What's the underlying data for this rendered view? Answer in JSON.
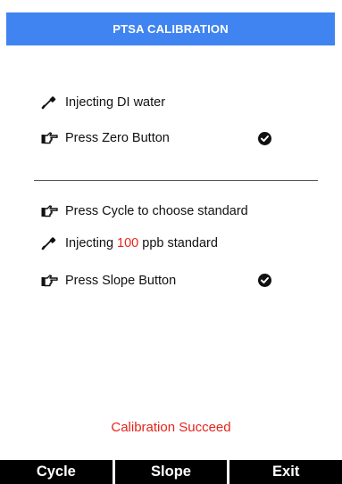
{
  "title": "PTSA CALIBRATION",
  "zero_section": {
    "inject_text": "Injecting DI water",
    "press_zero_text": "Press Zero Button",
    "zero_done": true
  },
  "slope_section": {
    "cycle_text": "Press Cycle to choose standard",
    "inject_prefix": "Injecting ",
    "standard_value": "100",
    "inject_suffix": " ppb standard",
    "press_slope_text": "Press Slope Button",
    "slope_done": true
  },
  "status_text": "Calibration Succeed",
  "softkeys": {
    "cycle": "Cycle",
    "slope": "Slope",
    "exit": "Exit"
  },
  "icons": {
    "inject": "dropper-icon",
    "press": "pointing-hand-icon",
    "done": "check-circle-icon"
  },
  "colors": {
    "title_bar": "#3f84f0",
    "highlight": "#e8231b",
    "softkey_bar": "#000000"
  }
}
